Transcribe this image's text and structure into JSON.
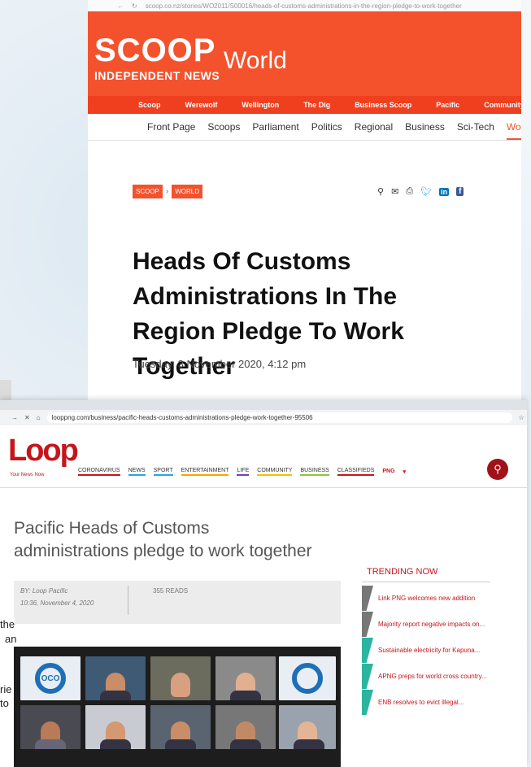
{
  "scoop": {
    "url": "scoop.co.nz/stories/WO2011/S00016/heads-of-customs-administrations-in-the-region-pledge-to-work-together",
    "logo": "SCOOP",
    "tagline": "INDEPENDENT NEWS",
    "section": "World",
    "subnav": [
      "Scoop",
      "Werewolf",
      "Wellington",
      "The Dig",
      "Business Scoop",
      "Pacific",
      "Community"
    ],
    "mainnav": [
      "Front Page",
      "Scoops",
      "Parliament",
      "Politics",
      "Regional",
      "Business",
      "Sci-Tech",
      "World"
    ],
    "active_nav": "World",
    "breadcrumb": [
      "SCOOP",
      "WORLD"
    ],
    "headline": "Heads Of Customs Administrations In The Region Pledge To Work Together",
    "date": "Tuesday, 3 November 2020, 4:12 pm"
  },
  "loop": {
    "url": "looppng.com/business/pacific-heads-customs-administrations-pledge-work-together-95506",
    "logo": "Loop",
    "logo_sub": "Your News Now",
    "nav": [
      "CORONAVIRUS",
      "NEWS",
      "SPORT",
      "ENTERTAINMENT",
      "LIFE",
      "COMMUNITY",
      "BUSINESS",
      "CLASSIFIEDS"
    ],
    "region": "PNG",
    "headline": "Pacific Heads of Customs administrations pledge to work together",
    "byline": "BY: Loop Pacific",
    "datetime": "10:36, November 4, 2020",
    "reads": "355 READS",
    "trending_title": "TRENDING NOW",
    "trending": [
      "Link PNG welcomes new addition",
      "Majority report negative impacts on...",
      "Sustainable electricity for Kapuna...",
      "APNG preps for world cross country...",
      "ENB resolves to evict illegal..."
    ],
    "photo_logo": "OCO"
  },
  "edge_text": [
    "the",
    "an",
    "rie",
    "to"
  ],
  "colors": {
    "scoop_orange": "#f4522d",
    "loop_red": "#c4161c"
  }
}
